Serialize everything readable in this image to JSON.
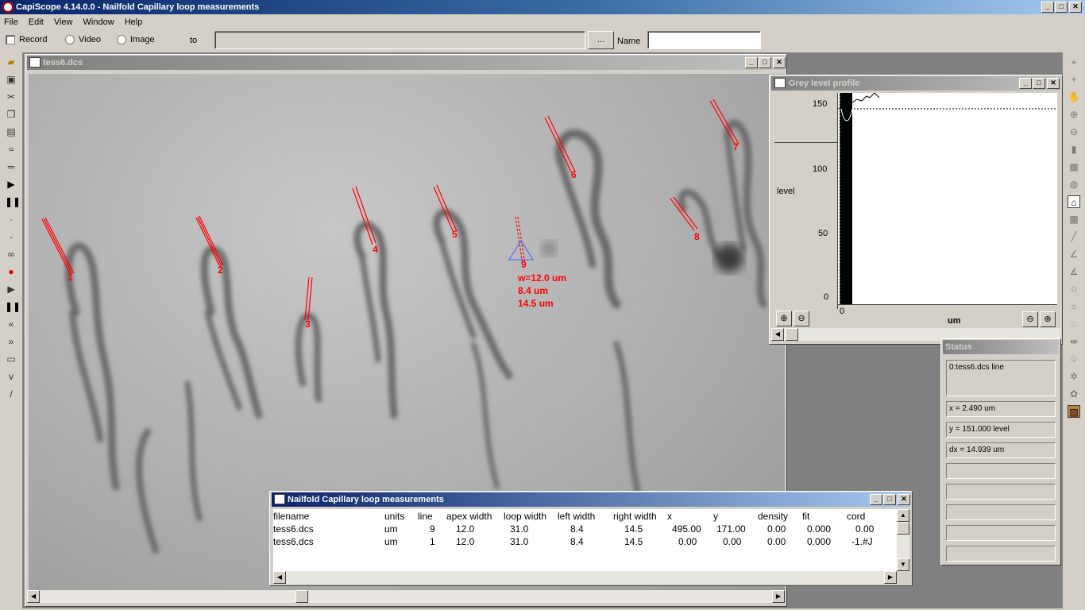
{
  "app": {
    "title": "CapiScope 4.14.0.0 - Nailfold Capillary loop measurements"
  },
  "menu": [
    "File",
    "Edit",
    "View",
    "Window",
    "Help"
  ],
  "toolbar": {
    "record": "Record",
    "video": "Video",
    "image": "Image",
    "to": "to",
    "browse": "...",
    "name": "Name"
  },
  "image_window": {
    "title": "tess6.dcs"
  },
  "markers": [
    "1",
    "2",
    "3",
    "4",
    "5",
    "6",
    "7",
    "8",
    "9"
  ],
  "measure_labels": {
    "w": "w=12.0 um",
    "l": "8.4 um",
    "r": "14.5 um"
  },
  "grey_window": {
    "title": "Grey level profile",
    "y_axis": "level",
    "x_axis": "um",
    "x_tick": "0",
    "y_ticks": [
      "150",
      "100",
      "50",
      "0"
    ]
  },
  "status": {
    "title": "Status",
    "fields": [
      "0:tess6.dcs line",
      "x = 2.490 um",
      "y = 151.000 level",
      "dx = 14.939 um"
    ]
  },
  "measurements": {
    "title": "Nailfold Capillary loop measurements",
    "columns": [
      "filename",
      "units",
      "line",
      "apex width",
      "loop width",
      "left width",
      "right width",
      "x",
      "y",
      "density",
      "fit",
      "cord"
    ],
    "rows": [
      [
        "tess6.dcs",
        "um",
        "9",
        "12.0",
        "31.0",
        "8.4",
        "14.5",
        "495.00",
        "171.00",
        "0.00",
        "0.000",
        "0.00"
      ],
      [
        "tess6.dcs",
        "um",
        "1",
        "12.0",
        "31.0",
        "8.4",
        "14.5",
        "0.00",
        "0.00",
        "0.00",
        "0.000",
        "-1.#J"
      ]
    ]
  }
}
